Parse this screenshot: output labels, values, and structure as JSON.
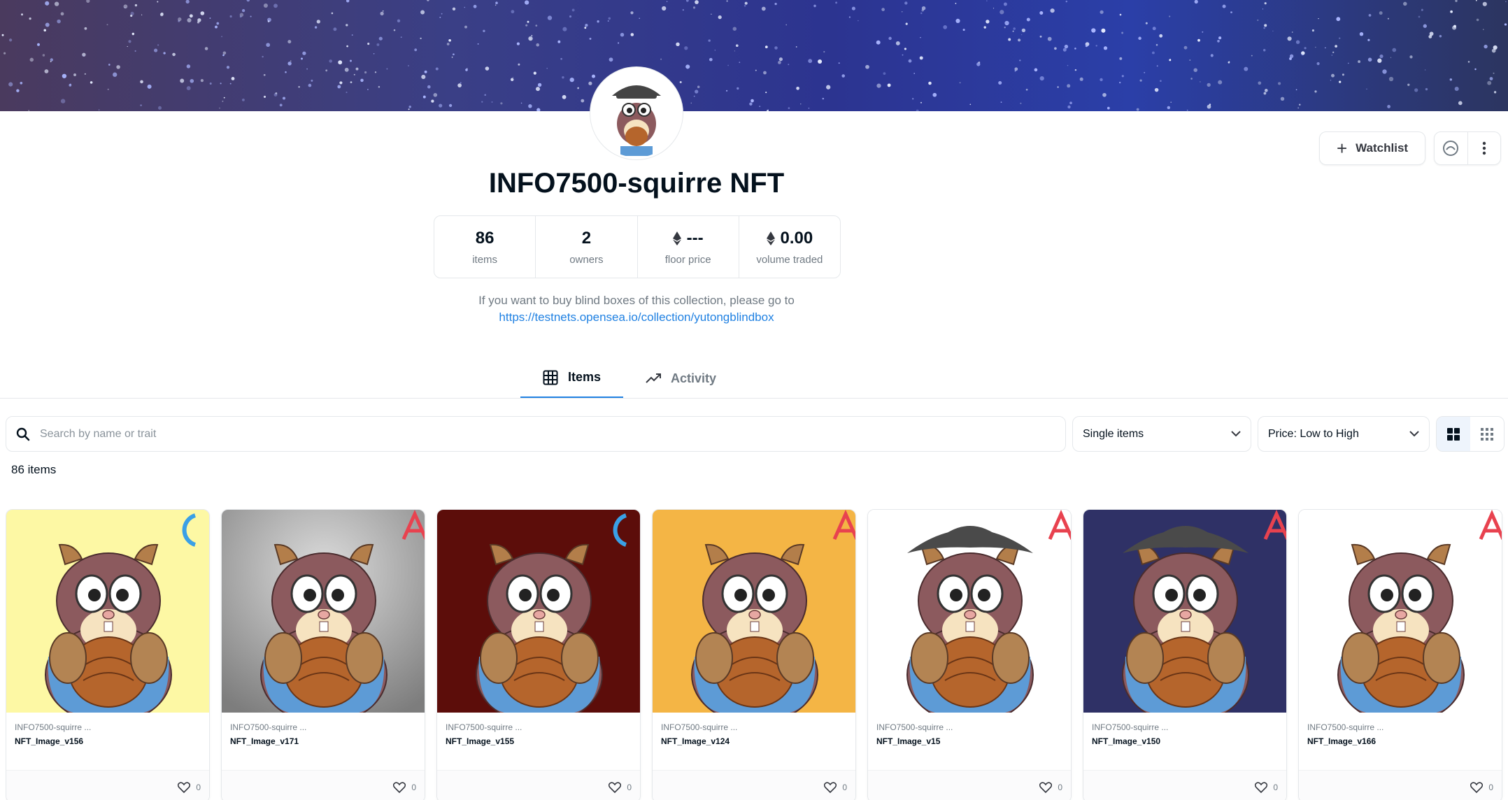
{
  "header": {
    "watchlist_label": "Watchlist"
  },
  "collection": {
    "title": "INFO7500-squirre NFT",
    "description": "If you want to buy blind boxes of this collection, please go to",
    "link": "https://testnets.opensea.io/collection/yutongblindbox"
  },
  "stats": [
    {
      "value": "86",
      "label": "items",
      "eth": false
    },
    {
      "value": "2",
      "label": "owners",
      "eth": false
    },
    {
      "value": "---",
      "label": "floor price",
      "eth": true
    },
    {
      "value": "0.00",
      "label": "volume traded",
      "eth": true
    }
  ],
  "tabs": [
    {
      "label": "Items",
      "icon": "grid-icon",
      "active": true
    },
    {
      "label": "Activity",
      "icon": "trend-icon",
      "active": false
    }
  ],
  "toolbar": {
    "search_placeholder": "Search by name or trait",
    "filter_value": "Single items",
    "sort_value": "Price: Low to High"
  },
  "results": {
    "count_label": "86 items"
  },
  "cards": [
    {
      "collection": "INFO7500-squirre ...",
      "name": "NFT_Image_v156",
      "likes": "0",
      "bg": "#fdf8a4",
      "hat": false,
      "badge": "ring",
      "vest": "#5d9bd6"
    },
    {
      "collection": "INFO7500-squirre ...",
      "name": "NFT_Image_v171",
      "likes": "0",
      "bg": "gray",
      "hat": false,
      "badge": "a",
      "vest": "#5d9bd6"
    },
    {
      "collection": "INFO7500-squirre ...",
      "name": "NFT_Image_v155",
      "likes": "0",
      "bg": "#5c0d0a",
      "hat": false,
      "badge": "ring",
      "vest": "#5d9bd6"
    },
    {
      "collection": "INFO7500-squirre ...",
      "name": "NFT_Image_v124",
      "likes": "0",
      "bg": "#f4b545",
      "hat": false,
      "badge": "a",
      "vest": "#5d9bd6"
    },
    {
      "collection": "INFO7500-squirre ...",
      "name": "NFT_Image_v15",
      "likes": "0",
      "bg": "#ffffff",
      "hat": true,
      "badge": "a",
      "vest": "#5d9bd6"
    },
    {
      "collection": "INFO7500-squirre ...",
      "name": "NFT_Image_v150",
      "likes": "0",
      "bg": "#2f3166",
      "hat": true,
      "badge": "a",
      "vest": "#5d9bd6"
    },
    {
      "collection": "INFO7500-squirre ...",
      "name": "NFT_Image_v166",
      "likes": "0",
      "bg": "#ffffff",
      "hat": false,
      "badge": "a",
      "vest": "#5d9bd6"
    }
  ]
}
